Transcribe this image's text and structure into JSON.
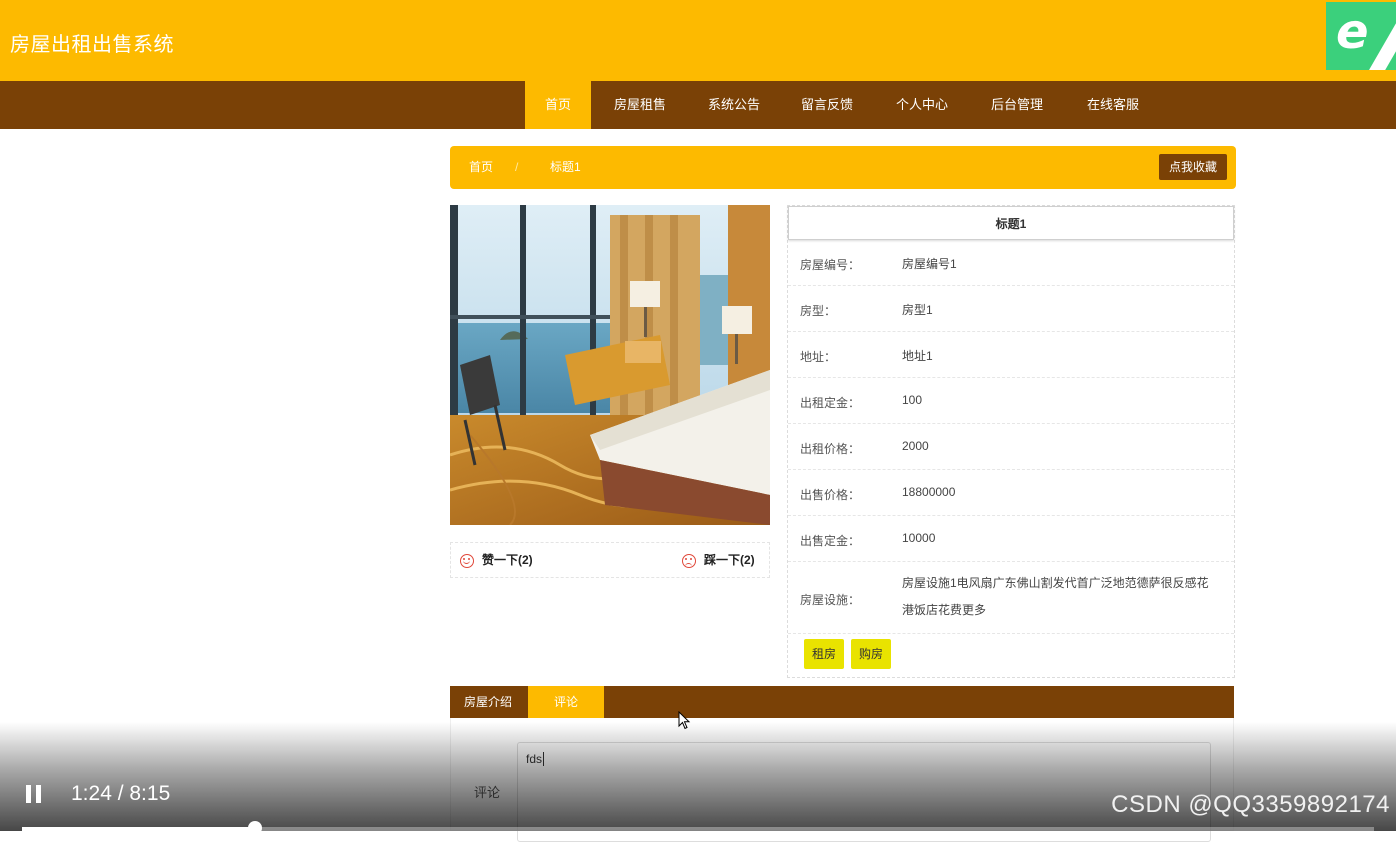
{
  "header": {
    "site_title": "房屋出租出售系统",
    "logo_icon": "ie-browser-icon"
  },
  "nav": {
    "items": [
      "首页",
      "房屋租售",
      "系统公告",
      "留言反馈",
      "个人中心",
      "后台管理",
      "在线客服"
    ],
    "active_index": 0
  },
  "breadcrumb": {
    "home": "首页",
    "separator": "/",
    "current": "标题1",
    "favorite_button": "点我收藏"
  },
  "votes": {
    "like_label": "赞一下(2)",
    "dislike_label": "踩一下(2)"
  },
  "detail": {
    "title": "标题1",
    "rows": [
      {
        "label": "房屋编号：",
        "value": "房屋编号1"
      },
      {
        "label": "房型：",
        "value": "房型1"
      },
      {
        "label": "地址：",
        "value": "地址1"
      },
      {
        "label": "出租定金：",
        "value": "100"
      },
      {
        "label": "出租价格：",
        "value": "2000"
      },
      {
        "label": "出售价格：",
        "value": "18800000"
      },
      {
        "label": "出售定金：",
        "value": "10000"
      },
      {
        "label": "房屋设施：",
        "value": "房屋设施1电风扇广东佛山割发代首广泛地范德萨很反感花港饭店花费更多"
      }
    ],
    "buttons": {
      "rent": "租房",
      "buy": "购房"
    }
  },
  "tabs": {
    "items": [
      "房屋介绍",
      "评论"
    ],
    "active_index": 1
  },
  "comment": {
    "label": "评论",
    "input_value": "fds"
  },
  "video": {
    "time": "1:24 / 8:15",
    "progress": 0.172,
    "watermark": "CSDN @QQ3359892174"
  },
  "colors": {
    "primary": "#fdba00",
    "secondary": "#7a4106",
    "action": "#e9e300"
  }
}
